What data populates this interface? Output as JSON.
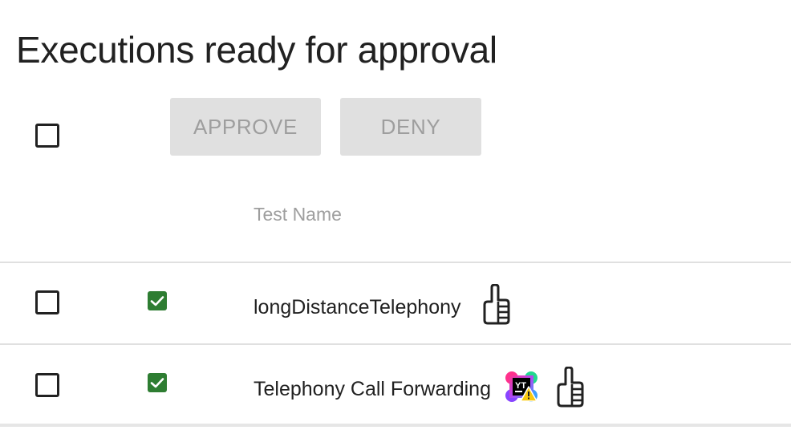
{
  "page": {
    "title": "Executions ready for approval"
  },
  "toolbar": {
    "approve_label": "APPROVE",
    "deny_label": "DENY",
    "select_all_checked": false
  },
  "table": {
    "columns": [
      "Test Name"
    ],
    "rows": [
      {
        "selected": false,
        "status": "passed",
        "name": "longDistanceTelephony",
        "icons": [
          "thumbs-up-icon"
        ]
      },
      {
        "selected": false,
        "status": "passed",
        "name": "Telephony Call Forwarding",
        "icons": [
          "youtrack-warning-icon",
          "thumbs-up-icon"
        ]
      }
    ]
  },
  "colors": {
    "status_passed": "#2e7d32",
    "button_disabled_bg": "#e0e0e0",
    "button_disabled_text": "#9e9e9e",
    "text_primary": "#212121",
    "text_secondary": "#9e9e9e"
  }
}
